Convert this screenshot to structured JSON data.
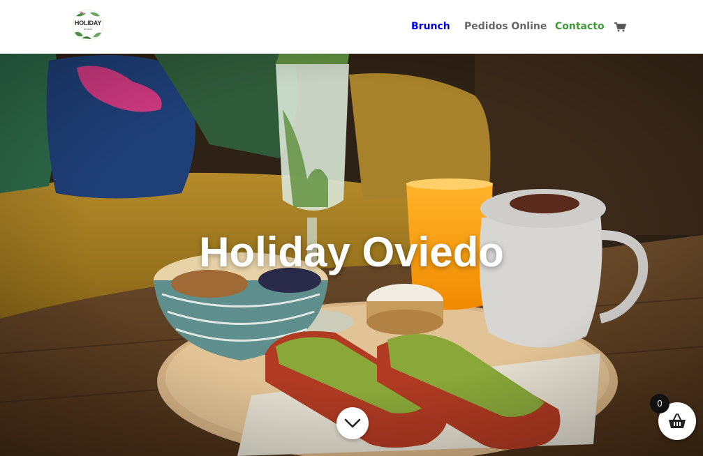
{
  "header": {
    "logo_text": "HOLIDAY",
    "logo_sub": "brunch",
    "nav": [
      {
        "label": "Brunch"
      },
      {
        "label": "Pedidos Online"
      },
      {
        "label": "Contacto"
      }
    ]
  },
  "hero": {
    "title": "Holiday Oviedo"
  },
  "basket": {
    "count": "0"
  },
  "colors": {
    "accent_green": "#3f9a3a",
    "nav_gray": "#666666"
  },
  "icons": [
    "cart-icon",
    "chevron-down-icon",
    "basket-icon"
  ]
}
